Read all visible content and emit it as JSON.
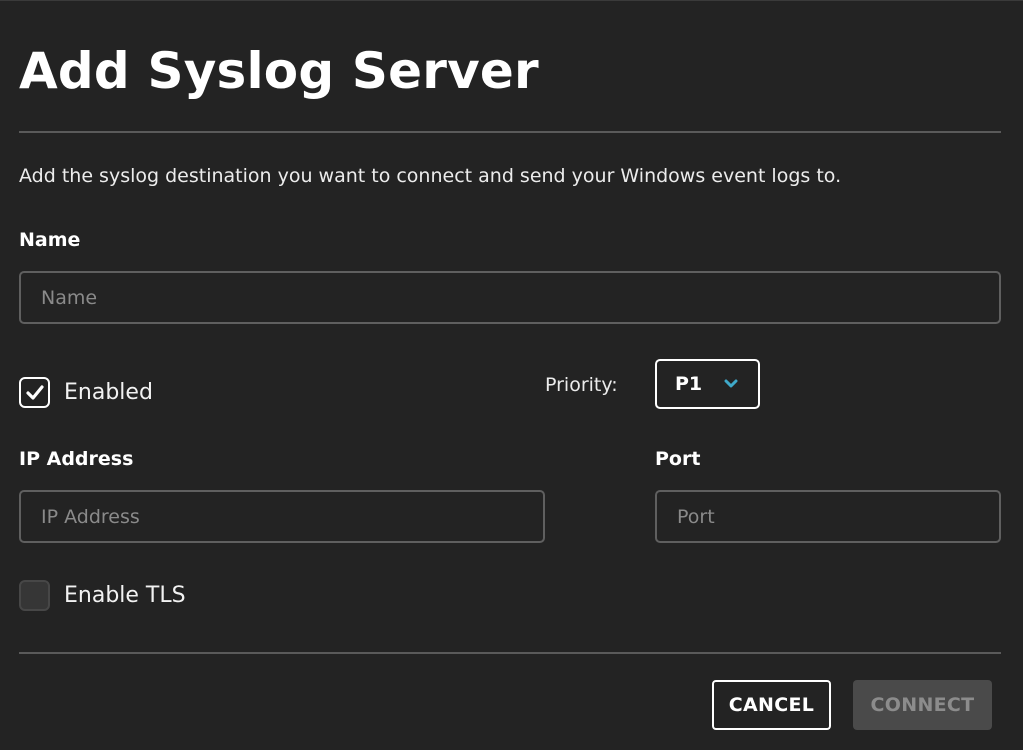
{
  "dialog": {
    "title": "Add Syslog Server",
    "description": "Add the syslog destination you want to connect and send your Windows event logs to."
  },
  "name_field": {
    "label": "Name",
    "placeholder": "Name",
    "value": ""
  },
  "enabled_checkbox": {
    "label": "Enabled",
    "checked": true,
    "icon": "check-icon"
  },
  "priority": {
    "label": "Priority:",
    "selected": "P1",
    "icon": "chevron-down-icon",
    "accent_color": "#3fa9c9"
  },
  "ip_field": {
    "label": "IP Address",
    "placeholder": "IP Address",
    "value": ""
  },
  "port_field": {
    "label": "Port",
    "placeholder": "Port",
    "value": ""
  },
  "tls_checkbox": {
    "label": "Enable TLS",
    "checked": false
  },
  "actions": {
    "cancel_label": "CANCEL",
    "connect_label": "CONNECT",
    "connect_disabled": true
  }
}
